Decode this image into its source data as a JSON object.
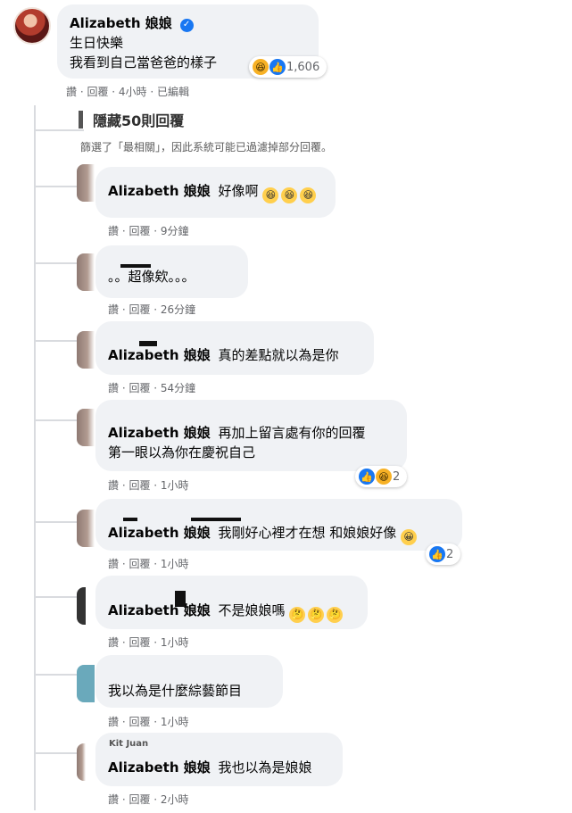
{
  "post": {
    "author": "Alizabeth 娘娘",
    "text_line1": "生日快樂",
    "text_line2": "我看到自己當爸爸的樣子",
    "reaction_count": "1,606",
    "actions": "讚 · 回覆 · 4小時 · 已編輯"
  },
  "hidden": {
    "link": "隱藏50則回覆",
    "notice": "篩選了「最相關」，因此系統可能已過濾掉部分回覆。"
  },
  "comments": [
    {
      "author": "Alizabeth 娘娘",
      "text": "好像啊",
      "actions": "讚 · 回覆 · 9分鐘"
    },
    {
      "author": "",
      "text": "。。超像欸。。。",
      "actions": "讚 · 回覆 · 26分鐘"
    },
    {
      "author": "Alizabeth 娘娘",
      "text": "真的差點就以為是你",
      "actions": "讚 · 回覆 · 54分鐘"
    },
    {
      "author": "Alizabeth 娘娘",
      "text": "再加上留言處有你的回覆",
      "text2": "第一眼以為你在慶祝自己",
      "actions": "讚 · 回覆 · 1小時",
      "reaction_count": "2"
    },
    {
      "author": "Alizabeth 娘娘",
      "text": "我剛好心裡才在想 和娘娘好像",
      "actions": "讚 · 回覆 · 1小時",
      "reaction_count": "2"
    },
    {
      "author": "Alizabeth 娘娘",
      "text": "不是娘娘嗎",
      "actions": "讚 · 回覆 · 1小時"
    },
    {
      "author": "",
      "text": "我以為是什麼綜藝節目",
      "actions": "讚 · 回覆 · 1小時"
    },
    {
      "author": "Alizabeth 娘娘",
      "text": "我也以為是娘娘",
      "actions": "讚 · 回覆 · 2小時",
      "overlap_name": "Kit Juan"
    }
  ]
}
